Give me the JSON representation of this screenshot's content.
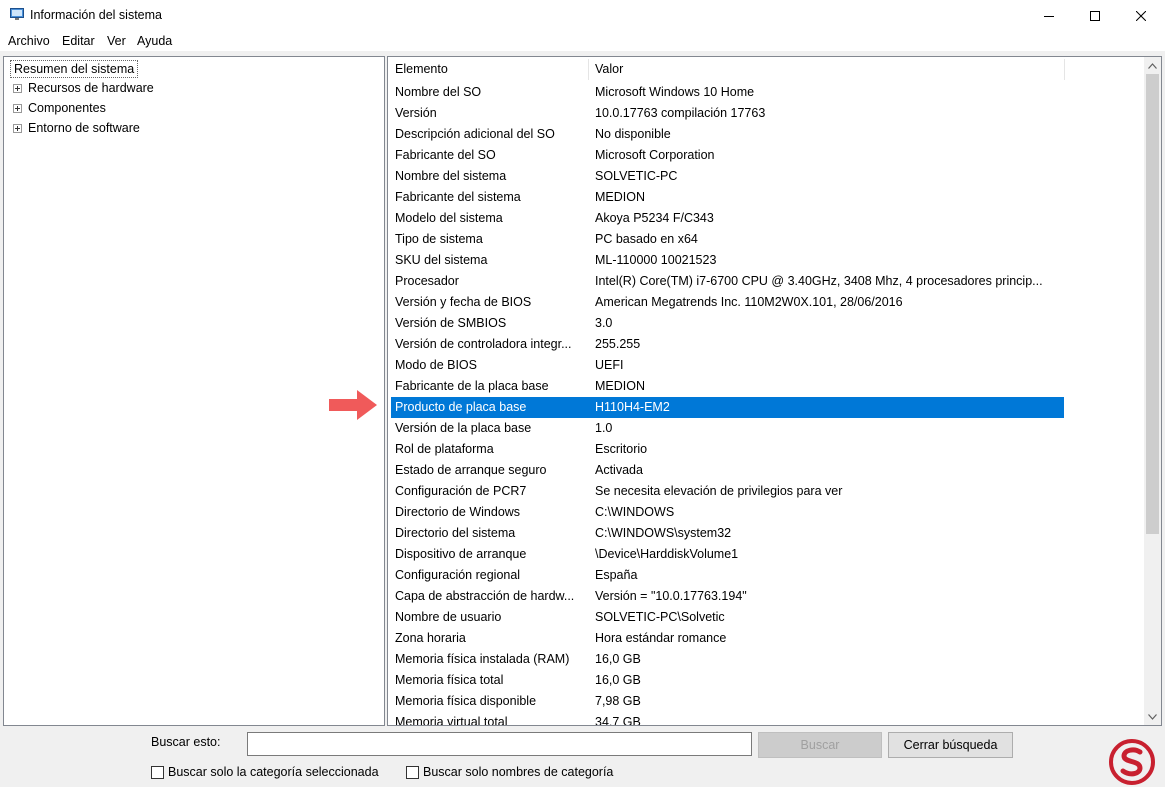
{
  "window": {
    "title": "Información del sistema"
  },
  "menu": {
    "items": [
      {
        "label": "Archivo"
      },
      {
        "label": "Editar"
      },
      {
        "label": "Ver"
      },
      {
        "label": "Ayuda"
      }
    ]
  },
  "tree": {
    "root": "Resumen del sistema",
    "nodes": [
      {
        "label": "Recursos de hardware"
      },
      {
        "label": "Componentes"
      },
      {
        "label": "Entorno de software"
      }
    ]
  },
  "list": {
    "columns": [
      "Elemento",
      "Valor"
    ],
    "selected_index": 15,
    "rows": [
      {
        "item": "Nombre del SO",
        "value": "Microsoft Windows 10 Home"
      },
      {
        "item": "Versión",
        "value": "10.0.17763 compilación 17763"
      },
      {
        "item": "Descripción adicional del SO",
        "value": "No disponible"
      },
      {
        "item": "Fabricante del SO",
        "value": "Microsoft Corporation"
      },
      {
        "item": "Nombre del sistema",
        "value": "SOLVETIC-PC"
      },
      {
        "item": "Fabricante del sistema",
        "value": "MEDION"
      },
      {
        "item": "Modelo del sistema",
        "value": "Akoya P5234 F/C343"
      },
      {
        "item": "Tipo de sistema",
        "value": "PC basado en x64"
      },
      {
        "item": "SKU del sistema",
        "value": "ML-110000 10021523"
      },
      {
        "item": "Procesador",
        "value": "Intel(R) Core(TM) i7-6700 CPU @ 3.40GHz, 3408 Mhz, 4 procesadores princip..."
      },
      {
        "item": "Versión y fecha de BIOS",
        "value": "American Megatrends Inc. 110M2W0X.101, 28/06/2016"
      },
      {
        "item": "Versión de SMBIOS",
        "value": "3.0"
      },
      {
        "item": "Versión de controladora integr...",
        "value": "255.255"
      },
      {
        "item": "Modo de BIOS",
        "value": "UEFI"
      },
      {
        "item": "Fabricante de la placa base",
        "value": "MEDION"
      },
      {
        "item": "Producto de placa base",
        "value": "H110H4-EM2"
      },
      {
        "item": "Versión de la placa base",
        "value": "1.0"
      },
      {
        "item": "Rol de plataforma",
        "value": "Escritorio"
      },
      {
        "item": "Estado de arranque seguro",
        "value": "Activada"
      },
      {
        "item": "Configuración de PCR7",
        "value": "Se necesita elevación de privilegios para ver"
      },
      {
        "item": "Directorio de Windows",
        "value": "C:\\WINDOWS"
      },
      {
        "item": "Directorio del sistema",
        "value": "C:\\WINDOWS\\system32"
      },
      {
        "item": "Dispositivo de arranque",
        "value": "\\Device\\HarddiskVolume1"
      },
      {
        "item": "Configuración regional",
        "value": "España"
      },
      {
        "item": "Capa de abstracción de hardw...",
        "value": "Versión = \"10.0.17763.194\""
      },
      {
        "item": "Nombre de usuario",
        "value": "SOLVETIC-PC\\Solvetic"
      },
      {
        "item": "Zona horaria",
        "value": "Hora estándar romance"
      },
      {
        "item": "Memoria física instalada (RAM)",
        "value": "16,0 GB"
      },
      {
        "item": "Memoria física total",
        "value": "16,0 GB"
      },
      {
        "item": "Memoria física disponible",
        "value": "7,98 GB"
      },
      {
        "item": "Memoria virtual total",
        "value": "34,7 GB"
      }
    ]
  },
  "search": {
    "label": "Buscar esto:",
    "value": "",
    "find_button": "Buscar",
    "close_button": "Cerrar búsqueda",
    "check_selected_category": "Buscar solo la categoría seleccionada",
    "check_category_names": "Buscar solo nombres de categoría"
  },
  "colors": {
    "selection": "#0078d7",
    "annotation_arrow": "#f05a5a",
    "logo": "#c8202f"
  }
}
